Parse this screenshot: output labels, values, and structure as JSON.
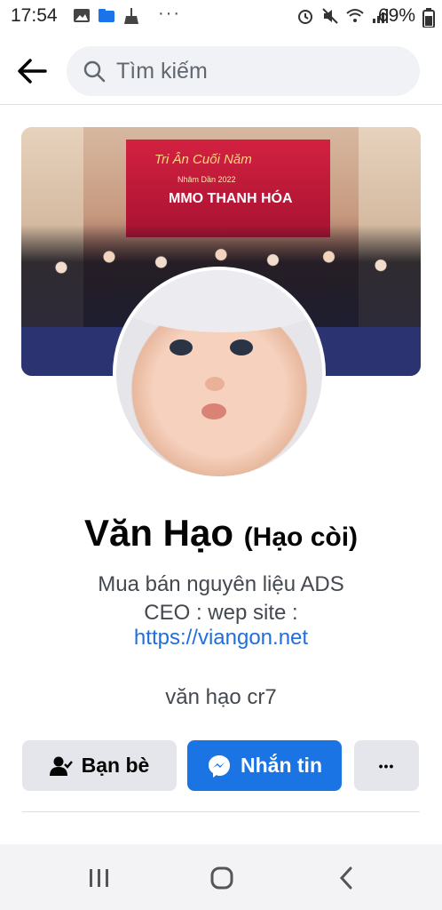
{
  "status_bar": {
    "time": "17:54",
    "overflow": "···",
    "battery": "69%"
  },
  "search": {
    "placeholder": "Tìm kiếm"
  },
  "cover": {
    "banner_title": "Tri Ân Cuối Năm",
    "banner_subtitle": "Nhâm Dần 2022",
    "banner_text": "MMO THANH HÓA"
  },
  "profile": {
    "name": "Văn Hạo",
    "alternate_name": "(Hạo còi)",
    "bio_line1": "Mua bán nguyên liệu ADS",
    "bio_line2": "CEO : wep site :",
    "link": "https://viangon.net",
    "secondary_name": "văn hạo cr7"
  },
  "actions": {
    "friends_label": "Bạn bè",
    "message_label": "Nhắn tin",
    "more_label": "•••"
  },
  "colors": {
    "primary_blue": "#1b74e4",
    "link_blue": "#216fdb",
    "button_gray": "#e4e6eb"
  },
  "icons": {
    "back": "arrow-left-icon",
    "search": "search-icon",
    "friends": "person-check-icon",
    "messenger": "messenger-icon",
    "recent_apps": "recent-apps-icon",
    "home": "home-icon",
    "nav_back": "chevron-left-icon"
  }
}
